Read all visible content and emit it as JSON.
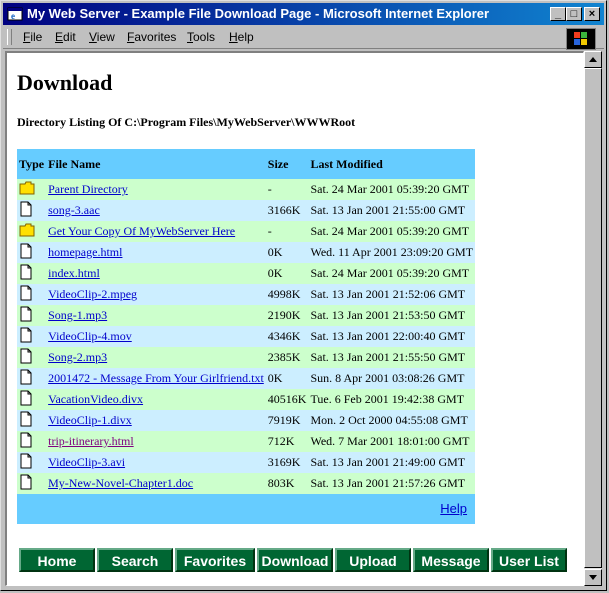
{
  "window": {
    "title": "My Web Server - Example File Download Page - Microsoft Internet Explorer",
    "minimize": "_",
    "maximize": "□",
    "close": "×"
  },
  "menu": [
    "File",
    "Edit",
    "View",
    "Favorites",
    "Tools",
    "Help"
  ],
  "page": {
    "heading": "Download",
    "directory_line": "Directory Listing Of C:\\Program Files\\MyWebServer\\WWWRoot",
    "columns": [
      "Type",
      "File Name",
      "Size",
      "Last Modified"
    ],
    "rows": [
      {
        "icon": "folder-icon",
        "name": "Parent Directory",
        "size": "-",
        "modified": "Sat. 24 Mar 2001 05:39:20 GMT"
      },
      {
        "icon": "file-icon",
        "name": "song-3.aac",
        "size": "3166K",
        "modified": "Sat. 13 Jan 2001 21:55:00 GMT"
      },
      {
        "icon": "folder-icon",
        "name": "Get Your Copy Of MyWebServer Here",
        "size": "-",
        "modified": "Sat. 24 Mar 2001 05:39:20 GMT"
      },
      {
        "icon": "file-icon",
        "name": "homepage.html",
        "size": "0K",
        "modified": "Wed. 11 Apr 2001 23:09:20 GMT"
      },
      {
        "icon": "file-icon",
        "name": "index.html",
        "size": "0K",
        "modified": "Sat. 24 Mar 2001 05:39:20 GMT"
      },
      {
        "icon": "file-icon",
        "name": "VideoClip-2.mpeg",
        "size": "4998K",
        "modified": "Sat. 13 Jan 2001 21:52:06 GMT"
      },
      {
        "icon": "file-icon",
        "name": "Song-1.mp3",
        "size": "2190K",
        "modified": "Sat. 13 Jan 2001 21:53:50 GMT"
      },
      {
        "icon": "file-icon",
        "name": "VideoClip-4.mov",
        "size": "4346K",
        "modified": "Sat. 13 Jan 2001 22:00:40 GMT"
      },
      {
        "icon": "file-icon",
        "name": "Song-2.mp3",
        "size": "2385K",
        "modified": "Sat. 13 Jan 2001 21:55:50 GMT"
      },
      {
        "icon": "file-icon",
        "name": "2001472 - Message From Your Girlfriend.txt",
        "size": "0K",
        "modified": "Sun. 8 Apr 2001 03:08:26 GMT"
      },
      {
        "icon": "file-icon",
        "name": "VacationVideo.divx",
        "size": "40516K",
        "modified": "Tue. 6 Feb 2001 19:42:38 GMT"
      },
      {
        "icon": "file-icon",
        "name": "VideoClip-1.divx",
        "size": "7919K",
        "modified": "Mon. 2 Oct 2000 04:55:08 GMT"
      },
      {
        "icon": "file-icon",
        "name": "trip-itinerary.html",
        "size": "712K",
        "modified": "Wed. 7 Mar 2001 18:01:00 GMT",
        "visited": true
      },
      {
        "icon": "file-icon",
        "name": "VideoClip-3.avi",
        "size": "3169K",
        "modified": "Sat. 13 Jan 2001 21:49:00 GMT"
      },
      {
        "icon": "file-icon",
        "name": "My-New-Novel-Chapter1.doc",
        "size": "803K",
        "modified": "Sat. 13 Jan 2001 21:57:26 GMT"
      }
    ],
    "help_link": "Help"
  },
  "nav_buttons": [
    "Home",
    "Search",
    "Favorites",
    "Download",
    "Upload",
    "Message",
    "User List"
  ],
  "colors": {
    "title_gradient_start": "#000080",
    "title_gradient_end": "#1084d0",
    "header_row": "#66ccff",
    "row_odd": "#ccffcc",
    "row_even": "#cceeff",
    "nav_button": "#006633",
    "link": "#0000cc",
    "visited_link": "#800080"
  }
}
